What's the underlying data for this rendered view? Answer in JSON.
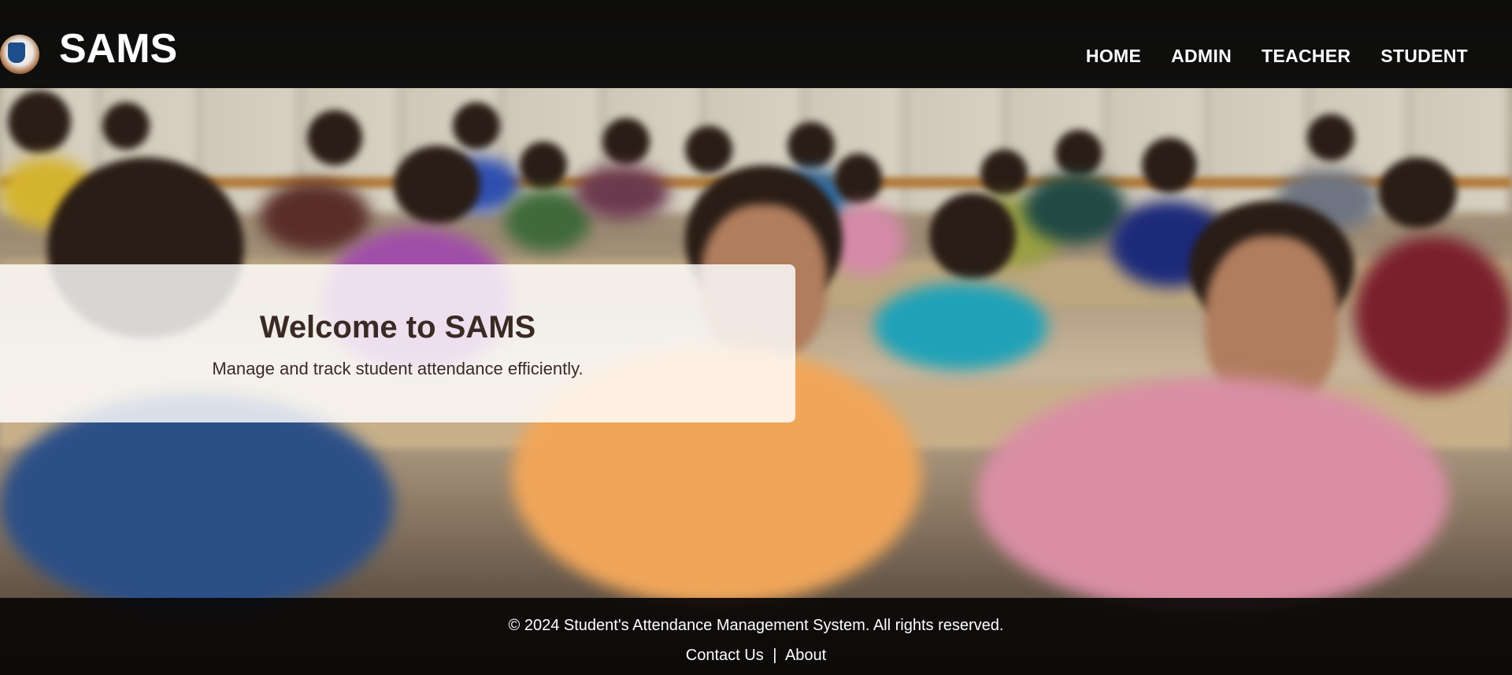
{
  "header": {
    "brand": "SAMS",
    "logo_icon": "school-logo-icon",
    "nav": [
      {
        "label": "HOME"
      },
      {
        "label": "ADMIN"
      },
      {
        "label": "TEACHER"
      },
      {
        "label": "STUDENT"
      }
    ]
  },
  "hero": {
    "title": "Welcome to SAMS",
    "subtitle": "Manage and track student attendance efficiently."
  },
  "footer": {
    "copyright": "© 2024 Student's Attendance Management System. All rights reserved.",
    "links": [
      {
        "label": "Contact Us"
      },
      {
        "label": "About"
      }
    ],
    "separator": "|"
  },
  "colors": {
    "header_bg": "#080808",
    "nav_text": "#ffffff",
    "hero_text": "#3a2a24",
    "footer_bg": "#0a0807"
  }
}
